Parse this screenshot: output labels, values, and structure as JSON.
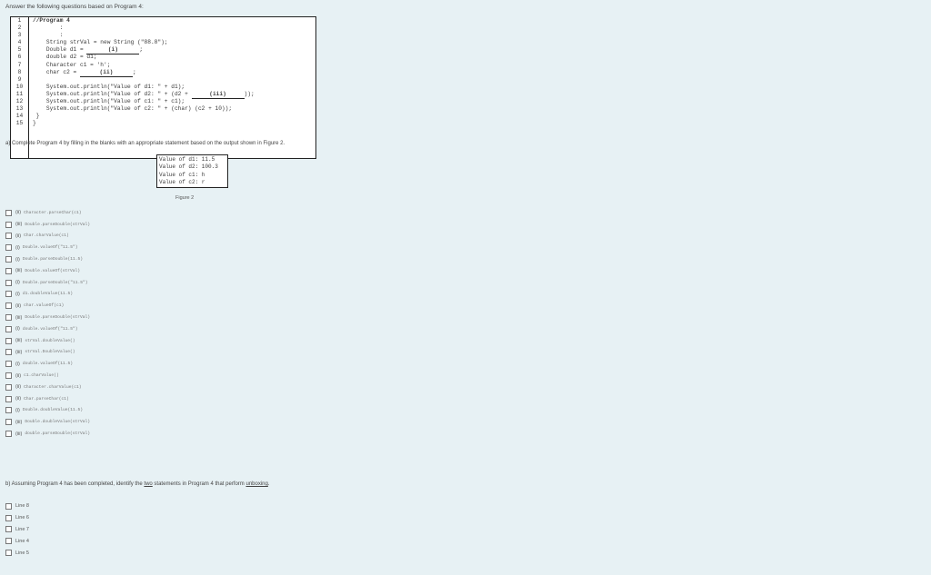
{
  "instruction": "Answer the following questions based on Program 4:",
  "program": {
    "line_numbers": [
      "1",
      "2",
      "3",
      "4",
      "5",
      "6",
      "7",
      "8",
      "9",
      "10",
      "11",
      "12",
      "13",
      "14",
      "15"
    ],
    "lines": [
      {
        "text": "//Program 4",
        "bold": true
      },
      {
        "text": "        :"
      },
      {
        "text": "        :"
      },
      {
        "text": "    String strVal = new String (\"88.8\");"
      },
      {
        "pre": "    Double d1 = ",
        "blank": "(i)",
        "post": ";"
      },
      {
        "text": "    double d2 = d1;"
      },
      {
        "text": "    Character c1 = 'h';"
      },
      {
        "pre": "    char c2 = ",
        "blank": "(ii)",
        "post": ";"
      },
      {
        "text": ""
      },
      {
        "text": "    System.out.println(\"Value of d1: \" + d1);"
      },
      {
        "pre": "    System.out.println(\"Value of d2: \" + (d2 + ",
        "blank": "(iii)",
        "post": "));"
      },
      {
        "text": "    System.out.println(\"Value of c1: \" + c1);"
      },
      {
        "text": "    System.out.println(\"Value of c2: \" + (char) (c2 + 10));"
      },
      {
        "text": " }"
      },
      {
        "text": "}"
      }
    ]
  },
  "question_a": "a) Complete Program 4 by filling in the blanks with an appropriate statement based on the output shown in Figure 2.",
  "output_lines": [
    "Value of d1: 11.5",
    "Value of d2: 100.3",
    "Value of c1: h",
    "Value of c2: r"
  ],
  "figure_caption": "Figure 2",
  "options_a": [
    {
      "tag": "(ii)",
      "text": "Character.parseChar(c1)"
    },
    {
      "tag": "(iii)",
      "text": "Double.parseDouble(strVal)"
    },
    {
      "tag": "(ii)",
      "text": "Char.charValue(c1)"
    },
    {
      "tag": "(i)",
      "text": "Double.valueOf(\"11.5\")"
    },
    {
      "tag": "(i)",
      "text": "Double.parseDouble(11.5)"
    },
    {
      "tag": "(iii)",
      "text": "Double.valueOf(strVal)"
    },
    {
      "tag": "(i)",
      "text": "Double.parseDouble(\"11.5\")"
    },
    {
      "tag": "(i)",
      "text": "d1.doubleValue(11.5)"
    },
    {
      "tag": "(ii)",
      "text": "char.valueOf(c1)"
    },
    {
      "tag": "(iii)",
      "text": "Double.parseDouble(strVal)"
    },
    {
      "tag": "(i)",
      "text": "double.valueOf(\"11.5\")"
    },
    {
      "tag": "(iii)",
      "text": "strVal.doubleValue()"
    },
    {
      "tag": "(iii)",
      "text": "strVal.DoubleValue()"
    },
    {
      "tag": "(i)",
      "text": "double.valueOf(11.5)"
    },
    {
      "tag": "(ii)",
      "text": "c1.charValue()"
    },
    {
      "tag": "(ii)",
      "text": "Character.charValue(c1)"
    },
    {
      "tag": "(ii)",
      "text": "Char.parseChar(c1)"
    },
    {
      "tag": "(i)",
      "text": "Double.doubleValue(11.5)"
    },
    {
      "tag": "(iii)",
      "text": "Double.doubleValue(strVal)"
    },
    {
      "tag": "(iii)",
      "text": "double.parseDouble(strVal)"
    }
  ],
  "question_b": {
    "pre": "b) Assuming Program 4 has been completed, identify the ",
    "u1": "two",
    "mid": " statements in Program 4 that perform ",
    "u2": "unboxing",
    "post": "."
  },
  "options_b": [
    "Line 8",
    "Line 6",
    "Line 7",
    "Line 4",
    "Line 5"
  ]
}
